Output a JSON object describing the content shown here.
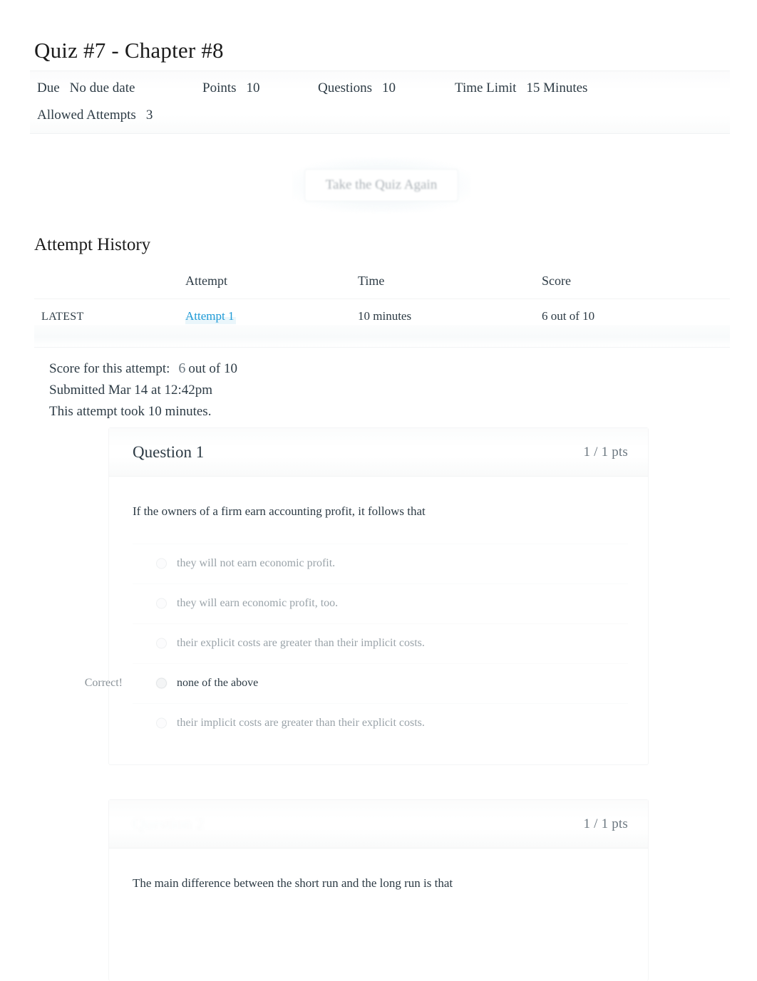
{
  "quiz": {
    "title": "Quiz #7 - Chapter #8",
    "meta": {
      "due_label": "Due",
      "due_value": "No due date",
      "points_label": "Points",
      "points_value": "10",
      "questions_label": "Questions",
      "questions_value": "10",
      "time_limit_label": "Time Limit",
      "time_limit_value": "15 Minutes",
      "allowed_attempts_label": "Allowed Attempts",
      "allowed_attempts_value": "3"
    },
    "retake_button_label": "Take the Quiz Again"
  },
  "attempt_history": {
    "section_title": "Attempt History",
    "columns": {
      "flag": "",
      "attempt": "Attempt",
      "time": "Time",
      "score": "Score"
    },
    "rows": [
      {
        "flag": "LATEST",
        "attempt": "Attempt 1",
        "time": "10 minutes",
        "score": "6 out of 10"
      }
    ]
  },
  "attempt_summary": {
    "score_label": "Score for this attempt:",
    "score_value": "6",
    "score_suffix": "out of 10",
    "submitted": "Submitted Mar 14 at 12:42pm",
    "duration": "This attempt took 10 minutes."
  },
  "questions": [
    {
      "name": "Question 1",
      "points": "1 / 1 pts",
      "text": "If the owners of a firm earn accounting profit, it follows that",
      "answers": [
        {
          "text": "they will not earn economic profit.",
          "selected": false,
          "status": ""
        },
        {
          "text": "they will earn economic profit, too.",
          "selected": false,
          "status": ""
        },
        {
          "text": "their explicit costs are greater than their implicit costs.",
          "selected": false,
          "status": ""
        },
        {
          "text": "none of the above",
          "selected": true,
          "status": "Correct!"
        },
        {
          "text": "their implicit costs are greater than their explicit costs.",
          "selected": false,
          "status": ""
        }
      ]
    },
    {
      "name": "Question 2",
      "points": "1 / 1 pts",
      "text": "The main difference between the short run and the long run is that",
      "answers": []
    }
  ],
  "colors": {
    "link": "#1f9ad6",
    "text": "#2d3b45",
    "muted": "#6b7780",
    "faded_answer": "#9aa3a9",
    "border": "#f2f3f4"
  }
}
